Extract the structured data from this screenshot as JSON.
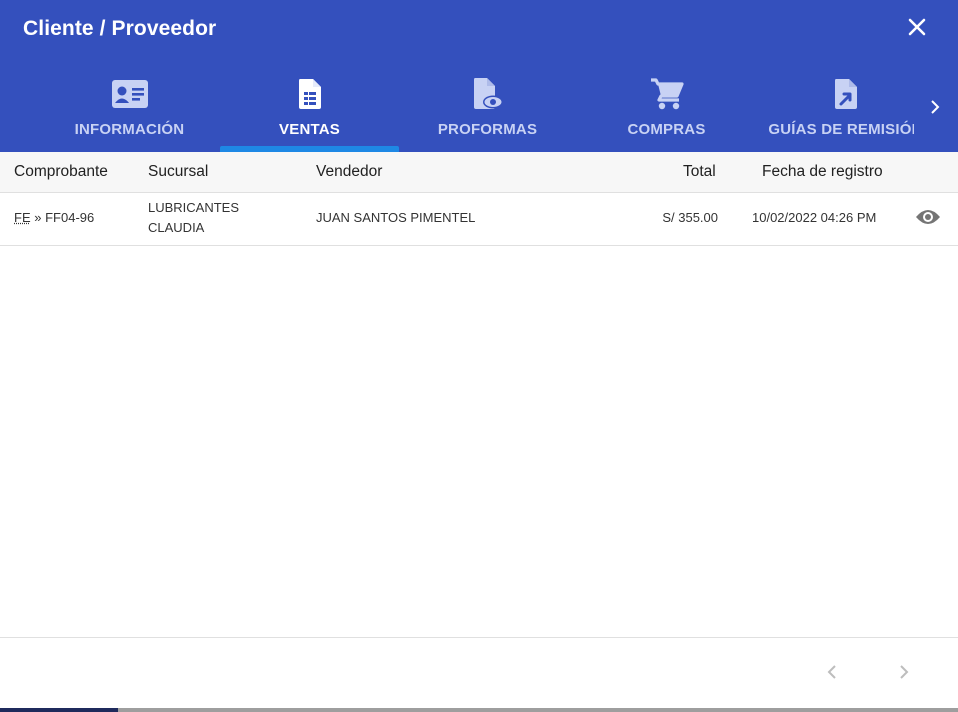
{
  "dialog": {
    "title": "Cliente / Proveedor",
    "close_icon": "close-icon"
  },
  "colors": {
    "header_bg": "#3450bd",
    "tab_indicator": "#1e88e5",
    "tab_inactive": "#c8d2f4",
    "tab_active": "#ffffff"
  },
  "tabs": [
    {
      "label": "INFORMACIÓN",
      "icon": "id-card-icon",
      "active": false
    },
    {
      "label": "VENTAS",
      "icon": "document-icon",
      "active": true
    },
    {
      "label": "PROFORMAS",
      "icon": "document-eye-icon",
      "active": false
    },
    {
      "label": "COMPRAS",
      "icon": "cart-icon",
      "active": false
    },
    {
      "label": "GUÍAS DE REMISIÓN",
      "icon": "document-arrow-icon",
      "active": false
    }
  ],
  "table": {
    "headers": {
      "comprobante": "Comprobante",
      "sucursal": "Sucursal",
      "vendedor": "Vendedor",
      "total": "Total",
      "fecha": "Fecha de registro"
    },
    "rows": [
      {
        "tipo": "FE",
        "separator": "»",
        "numero": "FF04-96",
        "sucursal_line1": "LUBRICANTES",
        "sucursal_line2": "CLAUDIA",
        "vendedor": "JUAN SANTOS PIMENTEL",
        "total": "S/ 355.00",
        "fecha": "10/02/2022 04:26 PM",
        "action_icon": "eye-icon"
      }
    ]
  },
  "pagination": {
    "prev_icon": "chevron-left-icon",
    "next_icon": "chevron-right-icon"
  }
}
